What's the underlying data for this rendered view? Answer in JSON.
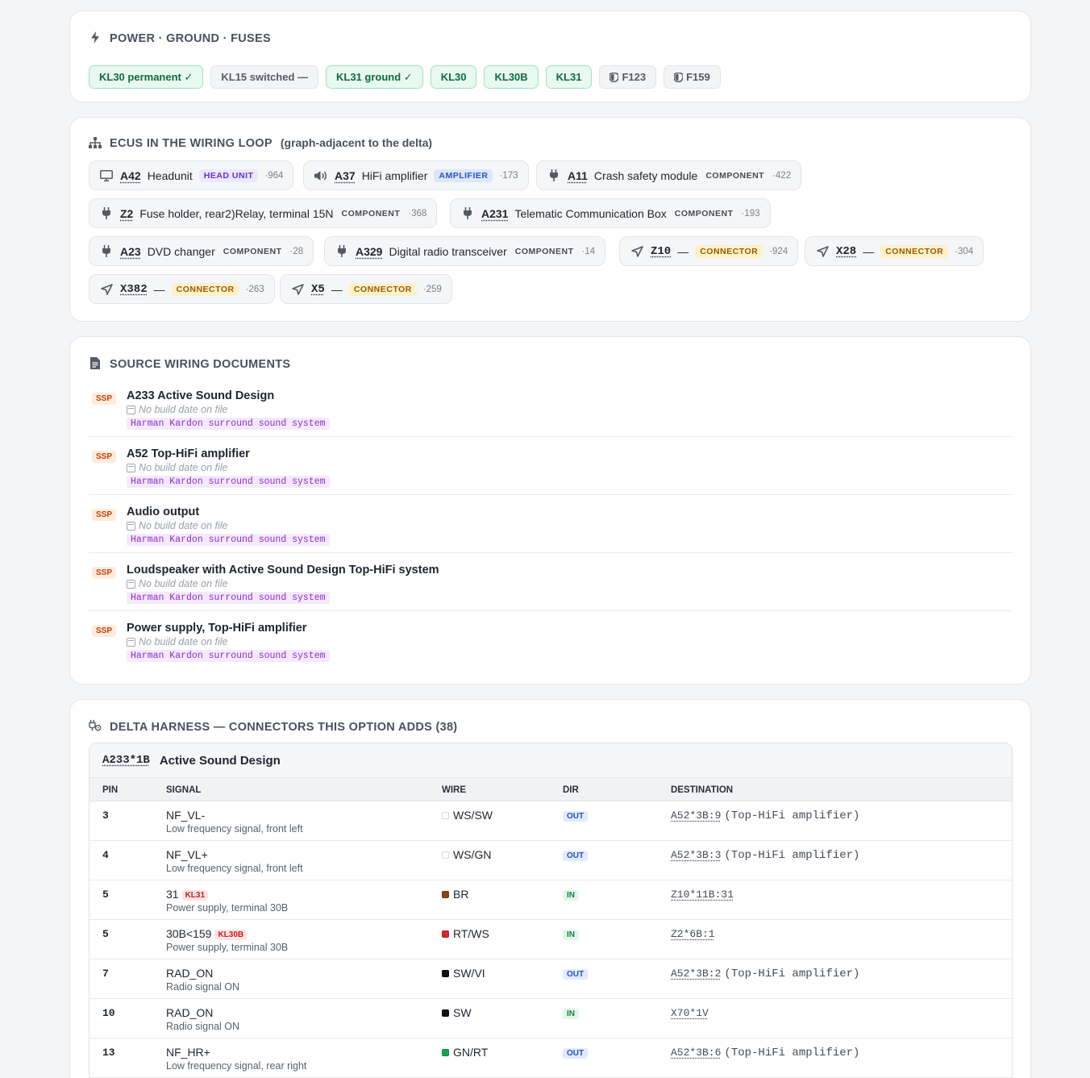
{
  "power": {
    "title": "POWER · GROUND · FUSES",
    "chips": [
      {
        "label": "KL30 permanent ✓",
        "style": "green"
      },
      {
        "label": "KL15 switched —",
        "style": "gray"
      },
      {
        "label": "KL31 ground ✓",
        "style": "green"
      },
      {
        "label": "KL30",
        "style": "green"
      },
      {
        "label": "KL30B",
        "style": "green"
      },
      {
        "label": "KL31",
        "style": "green"
      },
      {
        "label": "F123",
        "style": "gray",
        "icon": "shield-icon"
      },
      {
        "label": "F159",
        "style": "gray",
        "icon": "shield-icon"
      }
    ]
  },
  "ecus": {
    "title": "ECUS IN THE WIRING LOOP",
    "subtitle": "(graph-adjacent to the delta)",
    "items": [
      {
        "code": "A42",
        "name": "Headunit",
        "badge": "HEAD UNIT",
        "count": "·964",
        "icon": "monitor-icon"
      },
      {
        "code": "A37",
        "name": "HiFi amplifier",
        "badge": "AMPLIFIER",
        "count": "·173",
        "icon": "speaker-icon"
      },
      {
        "code": "A11",
        "name": "Crash safety module",
        "badge": "COMPONENT",
        "count": "·422",
        "icon": "plug-icon"
      },
      {
        "code": "Z2",
        "name": "Fuse holder, rear2)Relay, terminal 15N",
        "badge": "COMPONENT",
        "count": "·368",
        "icon": "plug-icon"
      },
      {
        "code": "A231",
        "name": "Telematic Communication Box",
        "badge": "COMPONENT",
        "count": "·193",
        "icon": "plug-icon"
      },
      {
        "code": "A23",
        "name": "DVD changer",
        "badge": "COMPONENT",
        "count": "·28",
        "icon": "plug-icon"
      },
      {
        "code": "A329",
        "name": "Digital radio transceiver",
        "badge": "COMPONENT",
        "count": "·14",
        "icon": "plug-icon"
      },
      {
        "code": "Z10",
        "name": "—",
        "badge": "CONNECTOR",
        "count": "·924",
        "icon": "connector-icon"
      },
      {
        "code": "X28",
        "name": "—",
        "badge": "CONNECTOR",
        "count": "·304",
        "icon": "connector-icon"
      },
      {
        "code": "X382",
        "name": "—",
        "badge": "CONNECTOR",
        "count": "·263",
        "icon": "connector-icon"
      },
      {
        "code": "X5",
        "name": "—",
        "badge": "CONNECTOR",
        "count": "·259",
        "icon": "connector-icon"
      }
    ]
  },
  "docs": {
    "title": "SOURCE WIRING DOCUMENTS",
    "items": [
      {
        "tag": "SSP",
        "title": "A233 Active Sound Design",
        "date": "No build date on file",
        "system": "Harman Kardon surround sound system"
      },
      {
        "tag": "SSP",
        "title": "A52 Top-HiFi amplifier",
        "date": "No build date on file",
        "system": "Harman Kardon surround sound system"
      },
      {
        "tag": "SSP",
        "title": "Audio output",
        "date": "No build date on file",
        "system": "Harman Kardon surround sound system"
      },
      {
        "tag": "SSP",
        "title": "Loudspeaker with Active Sound Design Top-HiFi system",
        "date": "No build date on file",
        "system": "Harman Kardon surround sound system"
      },
      {
        "tag": "SSP",
        "title": "Power supply, Top-HiFi amplifier",
        "date": "No build date on file",
        "system": "Harman Kardon surround sound system"
      }
    ]
  },
  "delta": {
    "title": "DELTA HARNESS — CONNECTORS THIS OPTION ADDS (38)",
    "connector": {
      "code": "A233*1B",
      "name": "Active Sound Design"
    },
    "columns": [
      "PIN",
      "SIGNAL",
      "WIRE",
      "DIR",
      "DESTINATION"
    ],
    "rows": [
      {
        "pin": "3",
        "signal": "NF_VL-",
        "kl": "",
        "desc": "Low frequency signal, front left",
        "wire": "WS/SW",
        "wire_color": "#ffffff",
        "dir": "OUT",
        "dest": "A52*3B:9",
        "dest_note": "(Top-HiFi amplifier)"
      },
      {
        "pin": "4",
        "signal": "NF_VL+",
        "kl": "",
        "desc": "Low frequency signal, front left",
        "wire": "WS/GN",
        "wire_color": "#ffffff",
        "dir": "OUT",
        "dest": "A52*3B:3",
        "dest_note": "(Top-HiFi amplifier)"
      },
      {
        "pin": "5",
        "signal": "31",
        "kl": "KL31",
        "desc": "Power supply, terminal 30B",
        "wire": "BR",
        "wire_color": "#8b4513",
        "dir": "IN",
        "dest": "Z10*11B:31",
        "dest_note": ""
      },
      {
        "pin": "5",
        "signal": "30B<159",
        "kl": "KL30B",
        "desc": "Power supply, terminal 30B",
        "wire": "RT/WS",
        "wire_color": "#dc2626",
        "dir": "IN",
        "dest": "Z2*6B:1",
        "dest_note": ""
      },
      {
        "pin": "7",
        "signal": "RAD_ON",
        "kl": "",
        "desc": "Radio signal ON",
        "wire": "SW/VI",
        "wire_color": "#111111",
        "dir": "OUT",
        "dest": "A52*3B:2",
        "dest_note": "(Top-HiFi amplifier)"
      },
      {
        "pin": "10",
        "signal": "RAD_ON",
        "kl": "",
        "desc": "Radio signal ON",
        "wire": "SW",
        "wire_color": "#111111",
        "dir": "IN",
        "dest": "X70*1V",
        "dest_note": ""
      },
      {
        "pin": "13",
        "signal": "NF_HR+",
        "kl": "",
        "desc": "Low frequency signal, rear right",
        "wire": "GN/RT",
        "wire_color": "#16a34a",
        "dir": "OUT",
        "dest": "A52*3B:6",
        "dest_note": "(Top-HiFi amplifier)"
      }
    ]
  },
  "colors": {
    "accent_green": "#0d6b3f",
    "connector_badge": "#9a5b00",
    "kl_red": "#c81e1e"
  }
}
